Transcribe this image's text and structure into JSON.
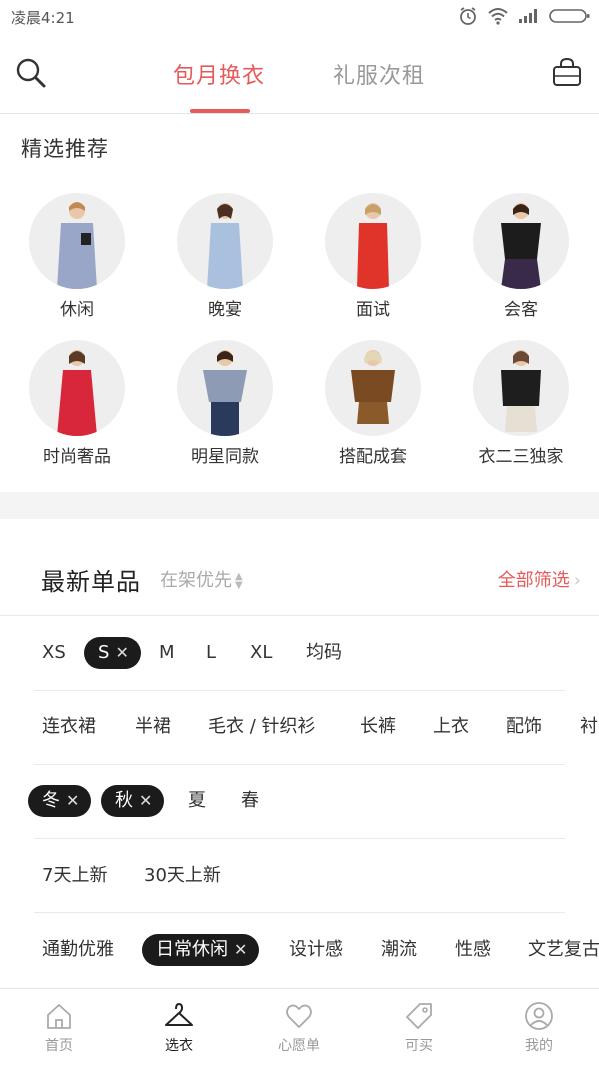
{
  "status_bar": {
    "time": "凌晨4:21"
  },
  "header": {
    "tabs": [
      {
        "label": "包月换衣"
      },
      {
        "label": "礼服次租"
      }
    ]
  },
  "featured": {
    "title": "精选推荐",
    "items": [
      {
        "label": "休闲"
      },
      {
        "label": "晚宴"
      },
      {
        "label": "面试"
      },
      {
        "label": "会客"
      },
      {
        "label": "时尚奢品"
      },
      {
        "label": "明星同款"
      },
      {
        "label": "搭配成套"
      },
      {
        "label": "衣二三独家"
      }
    ]
  },
  "latest": {
    "title": "最新单品",
    "sort_label": "在架优先",
    "filter_all": "全部筛选"
  },
  "filters": {
    "sizes": [
      "XS",
      "S",
      "M",
      "L",
      "XL",
      "均码"
    ],
    "categories": [
      "连衣裙",
      "半裙",
      "毛衣 / 针织衫",
      "长裤",
      "上衣",
      "配饰",
      "衬"
    ],
    "seasons": [
      "冬",
      "秋",
      "夏",
      "春"
    ],
    "newness": [
      "7天上新",
      "30天上新"
    ],
    "styles": [
      "通勤优雅",
      "日常休闲",
      "设计感",
      "潮流",
      "性感",
      "文艺复古"
    ]
  },
  "bottom_nav": {
    "items": [
      {
        "label": "首页"
      },
      {
        "label": "选衣"
      },
      {
        "label": "心愿单"
      },
      {
        "label": "可买"
      },
      {
        "label": "我的"
      }
    ]
  },
  "colors": {
    "accent": "#e55a5a",
    "chip_selected": "#1b1b1b"
  }
}
